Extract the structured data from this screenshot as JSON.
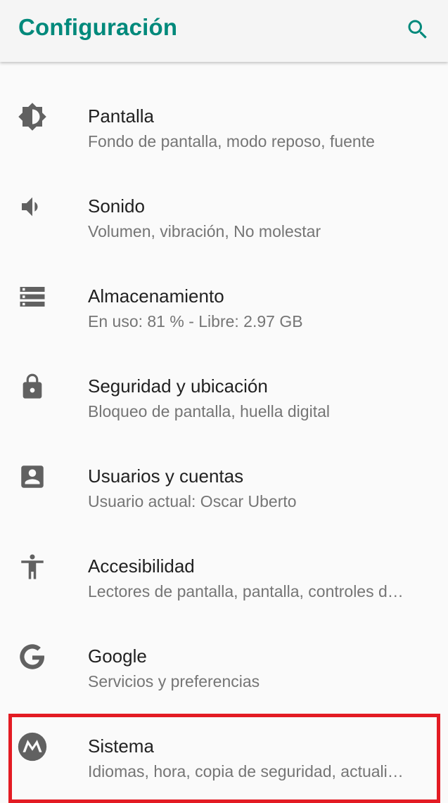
{
  "appbar": {
    "title": "Configuración",
    "search_icon": "search-icon"
  },
  "colors": {
    "accent": "#00897b",
    "icon": "#616161",
    "highlight": "#e31b23"
  },
  "settings": [
    {
      "icon": "brightness-icon",
      "title": "Pantalla",
      "subtitle": "Fondo de pantalla, modo reposo, fuente"
    },
    {
      "icon": "volume-icon",
      "title": "Sonido",
      "subtitle": "Volumen, vibración, No molestar"
    },
    {
      "icon": "storage-icon",
      "title": "Almacenamiento",
      "subtitle": "En uso: 81 % - Libre: 2.97 GB"
    },
    {
      "icon": "lock-icon",
      "title": "Seguridad y ubicación",
      "subtitle": "Bloqueo de pantalla, huella digital"
    },
    {
      "icon": "account-box-icon",
      "title": "Usuarios y cuentas",
      "subtitle": "Usuario actual: Oscar Uberto"
    },
    {
      "icon": "accessibility-icon",
      "title": "Accesibilidad",
      "subtitle": "Lectores de pantalla, pantalla, controles d…"
    },
    {
      "icon": "google-icon",
      "title": "Google",
      "subtitle": "Servicios y preferencias"
    },
    {
      "icon": "motorola-icon",
      "title": "Sistema",
      "subtitle": "Idiomas, hora, copia de seguridad, actuali…"
    }
  ]
}
